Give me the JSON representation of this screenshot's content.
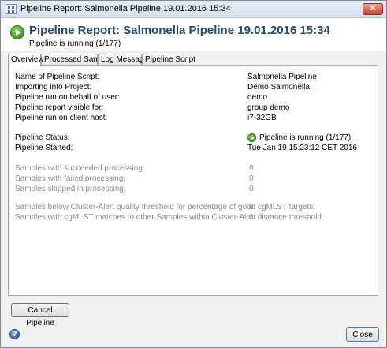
{
  "window": {
    "title": "Pipeline Report: Salmonella Pipeline 19.01.2016 15:34",
    "close_glyph": "✕"
  },
  "header": {
    "title": "Pipeline Report: Salmonella Pipeline 19.01.2016 15:34",
    "subtitle": "Pipeline is running (1/177)",
    "status_icon": "run-icon",
    "accent_color": "#27466b"
  },
  "tabs": [
    {
      "label": "Overview",
      "active": true
    },
    {
      "label": "Processed Samples",
      "active": false
    },
    {
      "label": "Log Messages",
      "active": false
    },
    {
      "label": "Pipeline Script",
      "active": false
    }
  ],
  "overview": {
    "info": [
      {
        "label": "Name of Pipeline Script:",
        "value": "Salmonella Pipeline"
      },
      {
        "label": "Importing into Project:",
        "value": "Demo Salmonella"
      },
      {
        "label": "Pipeline run on behalf of user:",
        "value": "demo"
      },
      {
        "label": "Pipeline report visible for:",
        "value": "group demo"
      },
      {
        "label": "Pipeline run on client host:",
        "value": "i7-32GB"
      }
    ],
    "status": [
      {
        "label": "Pipeline Status:",
        "value": "Pipeline is running (1/177)"
      },
      {
        "label": "Pipeline Started:",
        "value": "Tue Jan 19 15:23:12 CET 2016"
      }
    ],
    "processing": [
      {
        "label": "Samples with succeeded processing:",
        "value": "0"
      },
      {
        "label": "Samples with failed processing:",
        "value": "0"
      },
      {
        "label": "Samples skipped in processing:",
        "value": "0"
      }
    ],
    "cluster": [
      {
        "label": "Samples below Cluster-Alert quality threshold for percentage of good cgMLST targets:",
        "value": "0"
      },
      {
        "label": "Samples with cgMLST matches to other Samples within Cluster-Alert distance threshold:",
        "value": "0"
      }
    ]
  },
  "buttons": {
    "cancel": "Cancel Pipeline",
    "close": "Close",
    "help": "?"
  }
}
